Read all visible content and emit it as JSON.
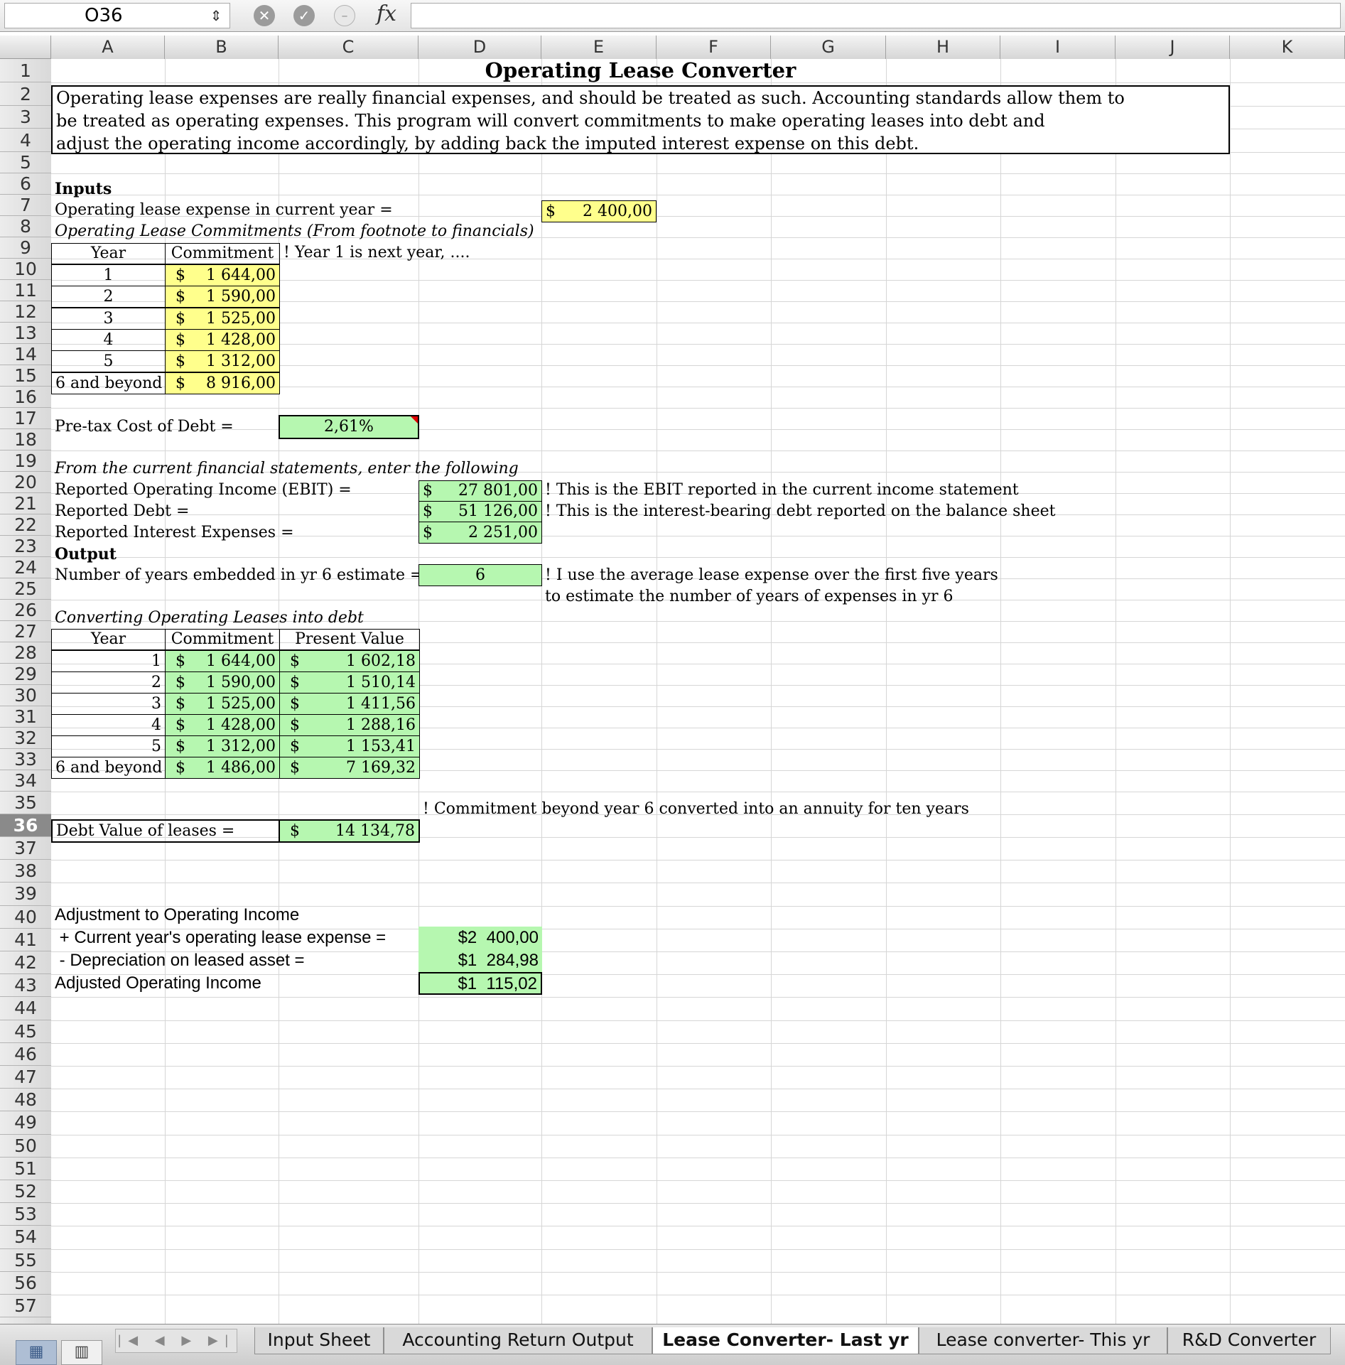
{
  "formula_bar": {
    "cell_reference": "O36",
    "cancel_icon": "x-circle-icon",
    "enter_icon": "check-circle-icon",
    "function_label": "fx",
    "formula": ""
  },
  "columns": [
    "A",
    "B",
    "C",
    "D",
    "E",
    "F",
    "G",
    "H",
    "I",
    "J",
    "K"
  ],
  "rows": [
    "1",
    "2",
    "3",
    "4",
    "5",
    "6",
    "7",
    "8",
    "9",
    "10",
    "11",
    "12",
    "13",
    "14",
    "15",
    "16",
    "17",
    "18",
    "19",
    "20",
    "21",
    "22",
    "23",
    "24",
    "25",
    "26",
    "27",
    "28",
    "29",
    "30",
    "31",
    "32",
    "33",
    "34",
    "35",
    "36",
    "37",
    "38",
    "39",
    "40",
    "41",
    "42",
    "43",
    "44",
    "45",
    "46",
    "47",
    "48",
    "49",
    "50",
    "51",
    "52",
    "53",
    "54",
    "55",
    "56",
    "57"
  ],
  "active_row": "36",
  "sheet": {
    "title": "Operating Lease Converter",
    "description_lines": [
      "Operating lease expenses are really financial expenses, and should be treated as such. Accounting standards allow them to",
      "be treated as operating expenses. This program will convert commitments to make operating leases into debt and",
      "adjust the operating income accordingly, by adding back the imputed interest expense on this debt."
    ],
    "inputs": {
      "heading": "Inputs",
      "lease_expense_label": "Operating lease expense in current year =",
      "lease_expense_currency": "$",
      "lease_expense_value": "2 400,00",
      "commitments_heading": "Operating Lease Commitments (From footnote to financials)",
      "year_header": "Year",
      "commitment_header": "Commitment",
      "year_note": "! Year 1 is next year, ....",
      "commitments": [
        {
          "year": "1",
          "currency": "$",
          "value": "1 644,00"
        },
        {
          "year": "2",
          "currency": "$",
          "value": "1 590,00"
        },
        {
          "year": "3",
          "currency": "$",
          "value": "1 525,00"
        },
        {
          "year": "4",
          "currency": "$",
          "value": "1 428,00"
        },
        {
          "year": "5",
          "currency": "$",
          "value": "1 312,00"
        },
        {
          "year": "6 and beyond",
          "currency": "$",
          "value": "8 916,00"
        }
      ],
      "cost_of_debt_label": "Pre-tax Cost of Debt =",
      "cost_of_debt_value": "2,61%"
    },
    "financials": {
      "heading": "From the current financial statements, enter the following",
      "ebit_label": "Reported Operating Income (EBIT) =",
      "ebit_currency": "$",
      "ebit_value": "27 801,00",
      "ebit_note": "! This is the EBIT reported in the current income statement",
      "debt_label": "Reported Debt =",
      "debt_currency": "$",
      "debt_value": "51 126,00",
      "debt_note": "! This is the interest-bearing debt reported on the balance sheet",
      "interest_label": "Reported Interest Expenses =",
      "interest_currency": "$",
      "interest_value": "2 251,00"
    },
    "output": {
      "heading": "Output",
      "years_label": "Number of years embedded in yr 6 estimate =",
      "years_value": "6",
      "years_note_1": "! I use the average lease expense over the first five years",
      "years_note_2": "to estimate the number of years of expenses in yr 6",
      "converting_heading": "Converting Operating Leases into debt",
      "year_header": "Year",
      "commitment_header": "Commitment",
      "pv_header": "Present Value",
      "rows": [
        {
          "year": "1",
          "c_cur": "$",
          "commitment": "1 644,00",
          "p_cur": "$",
          "pv": "1 602,18"
        },
        {
          "year": "2",
          "c_cur": "$",
          "commitment": "1 590,00",
          "p_cur": "$",
          "pv": "1 510,14"
        },
        {
          "year": "3",
          "c_cur": "$",
          "commitment": "1 525,00",
          "p_cur": "$",
          "pv": "1 411,56"
        },
        {
          "year": "4",
          "c_cur": "$",
          "commitment": "1 428,00",
          "p_cur": "$",
          "pv": "1 288,16"
        },
        {
          "year": "5",
          "c_cur": "$",
          "commitment": "1 312,00",
          "p_cur": "$",
          "pv": "1 153,41"
        },
        {
          "year": "6 and beyond",
          "c_cur": "$",
          "commitment": "1 486,00",
          "p_cur": "$",
          "pv": "7 169,32"
        }
      ],
      "beyond_note": "! Commitment beyond year 6 converted into an annuity for ten years",
      "debt_value_label": "Debt Value of leases =",
      "debt_value_currency": "$",
      "debt_value": "14 134,78"
    },
    "adjustment": {
      "heading": "Adjustment to Operating Income",
      "lease_label": " + Current year's operating lease expense =",
      "lease_value": "$2  400,00",
      "depr_label": " - Depreciation on leased asset =",
      "depr_value": "$1  284,98",
      "adj_label": "Adjusted Operating Income",
      "adj_value": "$1  115,02"
    }
  },
  "tabs": {
    "view_normal_icon": "normal-view-icon",
    "view_layout_icon": "page-layout-view-icon",
    "nav_arrows": "|◀ ◀ ▶ ▶|",
    "sheets": [
      "Input Sheet",
      "Accounting Return Output",
      "Lease Converter- Last yr",
      "Lease converter- This yr",
      "R&D Converter"
    ],
    "active_sheet": "Lease Converter- Last yr"
  }
}
